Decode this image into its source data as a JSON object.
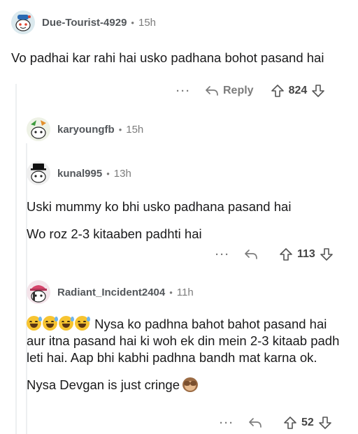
{
  "comments": [
    {
      "username": "Due-Tourist-4929",
      "time": "15h",
      "body": [
        "Vo padhai kar rahi hai usko padhana bohot pasand hai"
      ],
      "reply_label": "Reply",
      "votes": "824",
      "more": "···"
    },
    {
      "username": "karyoungfb",
      "time": "15h"
    },
    {
      "username": "kunal995",
      "time": "13h",
      "body": [
        "Uski mummy ko bhi usko padhana pasand hai",
        "Wo roz 2-3 kitaaben padhti hai"
      ],
      "votes": "113",
      "more": "···"
    },
    {
      "username": "Radiant_Incident2404",
      "time": "11h",
      "body_main": "Nysa ko padhna bahot bahot pasand hai aur itna pasand hai ki woh ek din mein 2-3 kitaab padh leti hai. Aap bhi kabhi padhna bandh mat karna ok.",
      "body_second": "Nysa Devgan is just cringe",
      "votes": "52",
      "more": "···"
    }
  ],
  "separator": "•",
  "icons": {
    "reply": "reply-arrow-icon",
    "upvote": "upvote-arrow-icon",
    "downvote": "downvote-arrow-icon",
    "grin_sweat": "grinning-sweat-emoji",
    "see_no_evil": "see-no-evil-monkey-emoji"
  }
}
